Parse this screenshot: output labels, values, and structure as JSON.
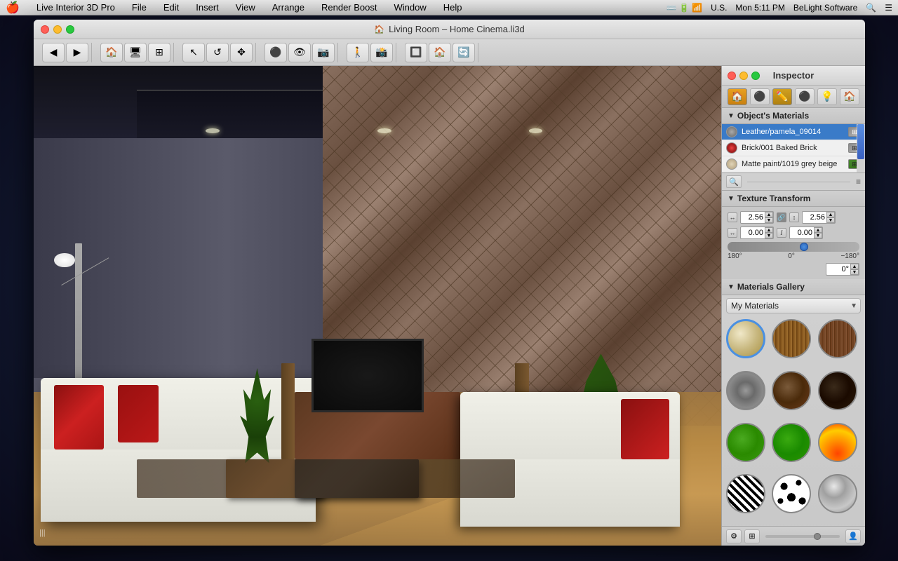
{
  "menubar": {
    "apple": "🍎",
    "items": [
      "Live Interior 3D Pro",
      "File",
      "Edit",
      "Insert",
      "View",
      "Arrange",
      "Render Boost",
      "Window",
      "Help"
    ],
    "right": {
      "time": "Mon 5:11 PM",
      "company": "BeLight Software",
      "locale": "U.S."
    }
  },
  "window": {
    "title": "Living Room – Home Cinema.li3d",
    "icon": "🏠"
  },
  "inspector": {
    "title": "Inspector",
    "tabs": [
      "🏠",
      "⚫",
      "✏️",
      "⚫",
      "💡",
      "🏠"
    ],
    "objects_materials_label": "Object's Materials",
    "materials": [
      {
        "name": "Leather/pamela_09014",
        "color": "#888888",
        "selected": true
      },
      {
        "name": "Brick/001 Baked Brick",
        "color": "#cc3333"
      },
      {
        "name": "Matte paint/1019 grey beige",
        "color": "#d4c4a8"
      }
    ],
    "texture_transform": {
      "label": "Texture Transform",
      "scale_x": "2.56",
      "scale_y": "2.56",
      "offset_x": "0.00",
      "offset_y": "0.00",
      "rotation_value": "0°",
      "rotation_min": "180°",
      "rotation_mid": "0°",
      "rotation_max": "−180°"
    },
    "gallery": {
      "label": "Materials Gallery",
      "dropdown_value": "My Materials",
      "swatches": [
        "beige",
        "wood1",
        "wood2",
        "stone",
        "brown",
        "darkbrown",
        "green1",
        "green2",
        "fire",
        "zebra",
        "spots",
        "metal"
      ]
    }
  },
  "viewport": {
    "scroll_indicator": "|||"
  }
}
